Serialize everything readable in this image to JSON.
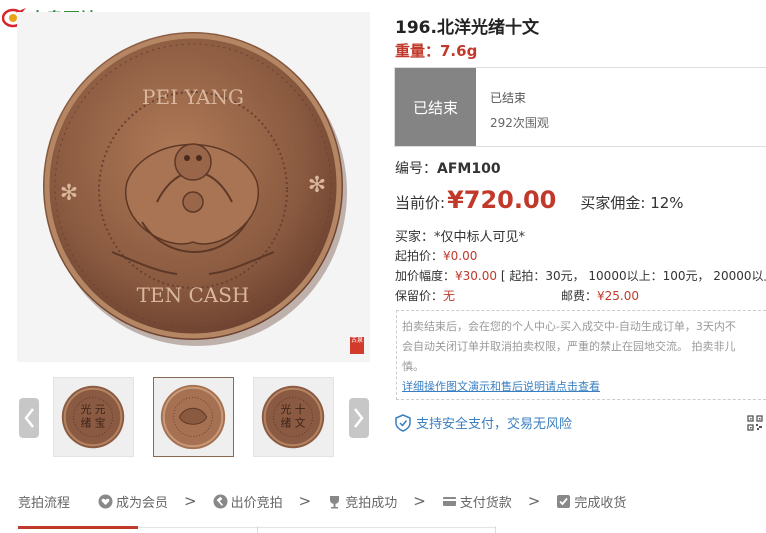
{
  "site": {
    "logo_text": "古泉园地"
  },
  "item": {
    "title": "196.北洋光绪十文",
    "weight": "重量：7.6g",
    "code_label": "编号：",
    "code_value": "AFM100"
  },
  "status": {
    "tag": "已结束",
    "info1": "已结束",
    "info2": "292次围观"
  },
  "price": {
    "label": "当前价:",
    "value": "¥720.00",
    "commission": "买家佣金: 12%"
  },
  "details": {
    "buyer_label": "买家：",
    "buyer_value": "*仅中标人可见*",
    "start_label": "起拍价：",
    "start_value": "¥0.00",
    "increment_label": "加价幅度：",
    "increment_value": "¥30.00",
    "increment_rule": " [ 起拍：30元， 10000以上：100元， 20000以上",
    "reserve_label": "保留价：",
    "reserve_value": "无",
    "shipping_label": "邮费：",
    "shipping_value": "¥25.00"
  },
  "notice": {
    "line1": "拍卖结束后，会在您的个人中心-买入成交中-自动生成订单，3天内不",
    "line2": "会自动关闭订单并取消拍卖权限，严重的禁止在园地交流。 拍卖非儿",
    "line3": "慎。",
    "link": "详细操作图文演示和售后说明请点击查看"
  },
  "secure_text": "支持安全支付，交易无风险",
  "process": {
    "title": "竞拍流程",
    "steps": [
      "成为会员",
      "出价竞拍",
      "竞拍成功",
      "支付货款",
      "完成收货"
    ],
    "separator": ">"
  },
  "seal_text": "古泉",
  "coin_text": {
    "top": "PEI YANG",
    "bottom": "TEN CASH"
  },
  "colors": {
    "accent_red": "#c0392b",
    "link_blue": "#3a7fc1",
    "status_gray": "#848484",
    "logo_green": "#2e8b3a"
  },
  "icons": [
    "logo-mark-icon",
    "chevron-left-icon",
    "chevron-right-icon",
    "shield-check-icon",
    "qr-code-icon",
    "heart-icon",
    "hammer-icon",
    "trophy-icon",
    "payment-icon",
    "check-box-icon"
  ]
}
